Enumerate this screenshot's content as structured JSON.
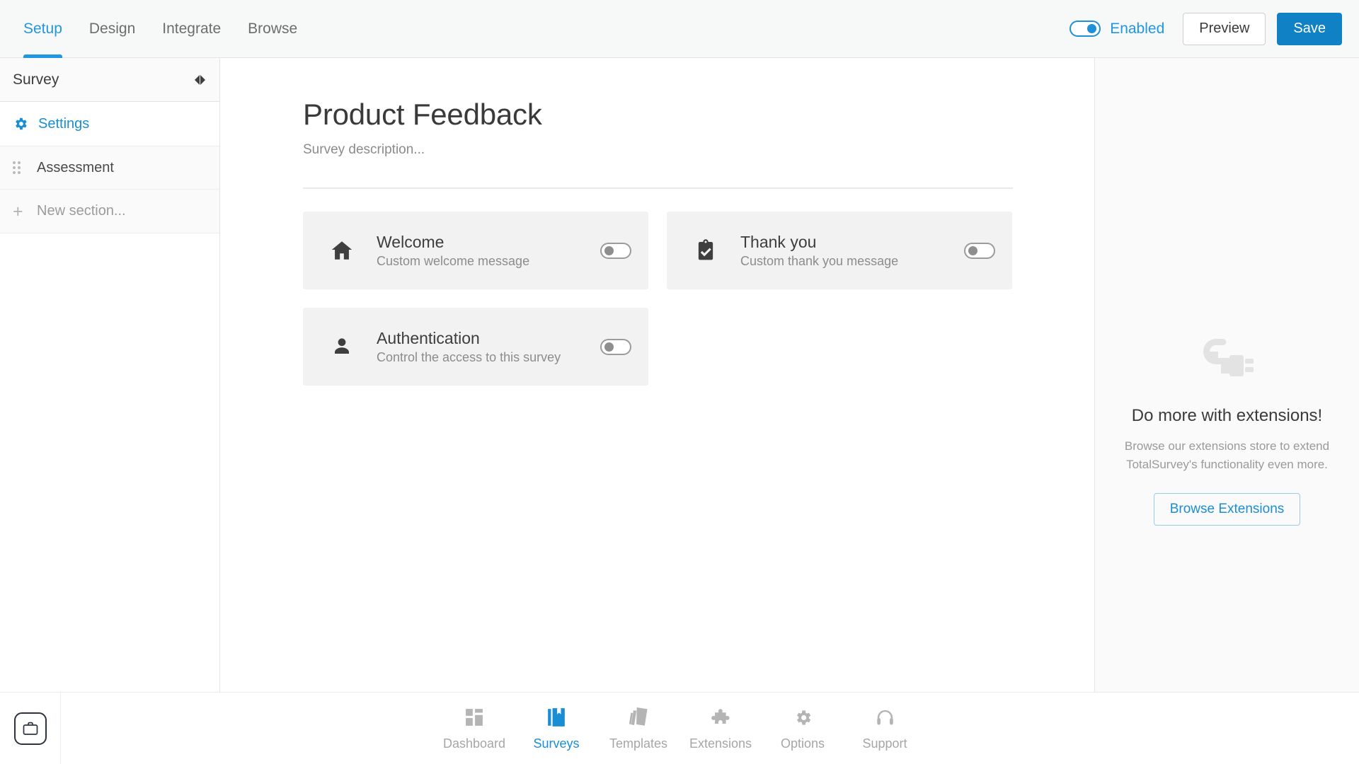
{
  "topbar": {
    "tabs": [
      {
        "label": "Setup",
        "active": true
      },
      {
        "label": "Design",
        "active": false
      },
      {
        "label": "Integrate",
        "active": false
      },
      {
        "label": "Browse",
        "active": false
      }
    ],
    "enabled_toggle": {
      "state": "on",
      "label": "Enabled"
    },
    "preview_button": "Preview",
    "save_button": "Save",
    "accent_color": "#2196e3",
    "primary_button_color": "#1181c6"
  },
  "sidebar": {
    "title": "Survey",
    "collapse_icon": "collapse-arrows-icon",
    "items": [
      {
        "label": "Settings",
        "icon": "gear-icon",
        "active": true
      },
      {
        "label": "Assessment",
        "icon": "drag-handle-icon",
        "active": false
      },
      {
        "label": "New section...",
        "icon": "plus-icon",
        "active": false
      }
    ]
  },
  "main": {
    "survey_title": "Product Feedback",
    "survey_description": "Survey description...",
    "cards": [
      {
        "title": "Welcome",
        "subtitle": "Custom welcome message",
        "icon": "home-icon",
        "toggle": "off"
      },
      {
        "title": "Thank you",
        "subtitle": "Custom thank you message",
        "icon": "clipboard-check-icon",
        "toggle": "off"
      },
      {
        "title": "Authentication",
        "subtitle": "Control the access to this survey",
        "icon": "user-icon",
        "toggle": "off"
      }
    ]
  },
  "right_panel": {
    "icon": "plug-icon",
    "title": "Do more with extensions!",
    "description": "Browse our extensions store to extend TotalSurvey's functionality even more.",
    "button_label": "Browse Extensions"
  },
  "bottombar": {
    "app_icon": "briefcase-icon",
    "items": [
      {
        "label": "Dashboard",
        "icon": "dashboard-grid-icon",
        "active": false
      },
      {
        "label": "Surveys",
        "icon": "book-bookmark-icon",
        "active": true
      },
      {
        "label": "Templates",
        "icon": "templates-cards-icon",
        "active": false
      },
      {
        "label": "Extensions",
        "icon": "puzzle-piece-icon",
        "active": false
      },
      {
        "label": "Options",
        "icon": "gear-icon",
        "active": false
      },
      {
        "label": "Support",
        "icon": "headset-icon",
        "active": false
      }
    ]
  }
}
